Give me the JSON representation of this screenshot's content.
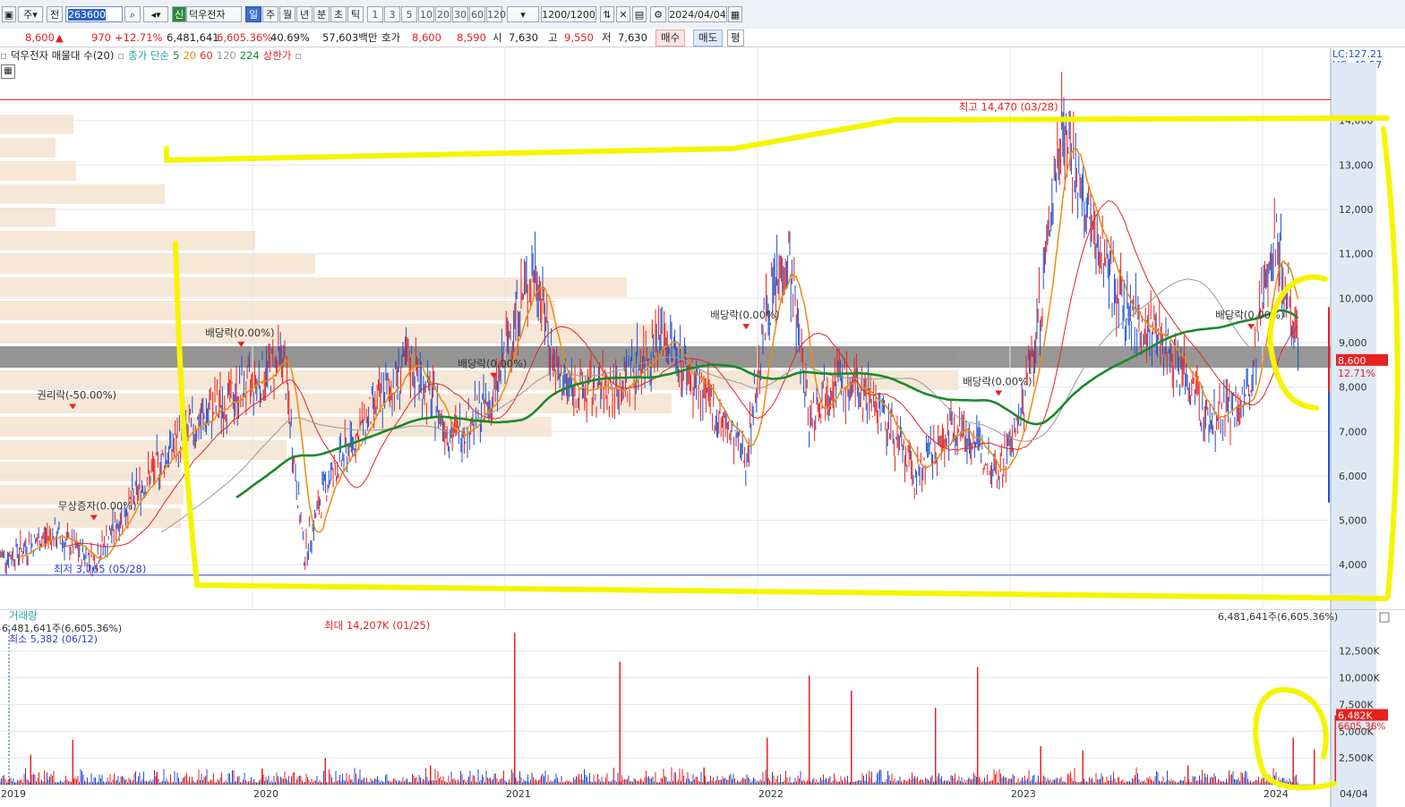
{
  "toolbar": {
    "market_btn": "주",
    "all_btn": "전",
    "code": "263600",
    "new_badge": "신",
    "stock_name": "덕우전자",
    "periods": [
      "일",
      "주",
      "월",
      "년",
      "분",
      "초",
      "틱"
    ],
    "active_period": "일",
    "intervals": [
      "1",
      "3",
      "5",
      "10",
      "20",
      "30",
      "60",
      "120"
    ],
    "count_label": "1200",
    "count_total": "/1200",
    "date": "2024/04/04"
  },
  "quote": {
    "price": "8,600",
    "change": "970",
    "change_pct": "+12.71%",
    "volume": "6,481,641",
    "volume_pct": "6,605.36%",
    "turnover": "40.69%",
    "amount": "57,603백만",
    "bid_label": "호가",
    "bid1": "8,600",
    "bid2": "8,590",
    "open_label": "시",
    "open": "7,630",
    "high_label": "고",
    "high": "9,550",
    "low_label": "저",
    "low": "7,630",
    "buy": "매수",
    "sell": "매도",
    "eval": "평"
  },
  "legend": {
    "title": "덕우전자 매물대 수(20)",
    "ma_label": "종가 단순",
    "ma5": "5",
    "ma20": "20",
    "ma60": "60",
    "ma120": "120",
    "ma224": "224",
    "upper_limit": "상한가"
  },
  "right_info": {
    "lc": "LC:127.21",
    "hc": "HC:-40.57"
  },
  "colors": {
    "up": "#e8201e",
    "down": "#1f4fd0",
    "ma5": "#f08a10",
    "ma20": "#e0242a",
    "ma60": "#9a9a9a",
    "ma224": "#1a8a2a",
    "highlight": "#f5f500",
    "volume_profile": "#f6e7d6"
  },
  "chart_data": [
    {
      "type": "line",
      "title": "",
      "x_ticks": [
        "2019",
        "2020",
        "2021",
        "2022",
        "2023",
        "2024",
        "04/04"
      ],
      "y_ticks": [
        "4,000",
        "5,000",
        "6,000",
        "7,000",
        "8,000",
        "9,000",
        "10,000",
        "11,000",
        "12,000",
        "13,000",
        "14,000"
      ],
      "ylim": [
        3300,
        14900
      ],
      "series": [
        {
          "color": "#1f4fd0",
          "x": [
            "2019-01",
            "2019-03",
            "2019-05",
            "2019-07",
            "2019-09",
            "2019-11",
            "2020-01",
            "2020-02",
            "2020-03",
            "2020-04",
            "2020-06",
            "2020-08",
            "2020-10",
            "2020-12",
            "2021-01",
            "2021-02",
            "2021-03",
            "2021-04",
            "2021-06",
            "2021-08",
            "2021-10",
            "2021-12",
            "2022-01",
            "2022-02",
            "2022-03",
            "2022-04",
            "2022-06",
            "2022-08",
            "2022-10",
            "2022-12",
            "2023-01",
            "2023-02",
            "2023-03",
            "2023-04",
            "2023-05",
            "2023-06",
            "2023-08",
            "2023-10",
            "2023-12",
            "2024-01",
            "2024-02",
            "2024-03",
            "2024-04"
          ],
          "values": [
            4200,
            4700,
            4100,
            5600,
            6800,
            7600,
            8200,
            8700,
            4200,
            5800,
            7300,
            8600,
            6900,
            7700,
            9600,
            10700,
            8200,
            7900,
            8000,
            9200,
            7800,
            6400,
            9800,
            11000,
            7300,
            8200,
            7800,
            6000,
            7200,
            6100,
            7200,
            9800,
            14200,
            12000,
            11000,
            9700,
            9000,
            7200,
            7800,
            11600,
            9600,
            7500,
            8600
          ]
        }
      ],
      "annotations": [
        {
          "text": "최고 14,470 (03/28)",
          "x": "2023-03-28",
          "y": 14470
        },
        {
          "text": "최저 3,765 (05/28)",
          "x": "2019-05-28",
          "y": 3765
        },
        {
          "text": "배당락(0.00%)",
          "x": "2019-12",
          "y": 8900
        },
        {
          "text": "배당락(0.00%)",
          "x": "2020-12",
          "y": 8200
        },
        {
          "text": "배당락(0.00%)",
          "x": "2021-12",
          "y": 9300
        },
        {
          "text": "배당락(0.00%)",
          "x": "2022-12",
          "y": 7800
        },
        {
          "text": "배당락(0.00%)",
          "x": "2023-12",
          "y": 9300
        },
        {
          "text": "권리락(-50.00%)",
          "x": "2019-04",
          "y": 7500
        },
        {
          "text": "무상증자(0.00%)",
          "x": "2019-05",
          "y": 5000
        }
      ],
      "price_label": {
        "price": "8,600",
        "pct": "12.71%"
      }
    },
    {
      "type": "bar",
      "title": "거래량",
      "info": "6,481,641주(6,605.36%)",
      "min_label": "최소 5,382 (06/12)",
      "max_label": "최대 14,207K (01/25)",
      "right_info": "6,481,641주(6,605.36%)",
      "y_ticks": [
        "2,500K",
        "5,000K",
        "7,500K",
        "10,000K",
        "12,500K"
      ],
      "ylim": [
        0,
        14900
      ],
      "current_label": "6,482K",
      "current_pct": "6605.36%",
      "x": [
        "2019-02",
        "2019-04",
        "2019-08",
        "2020-01",
        "2020-04",
        "2020-09",
        "2021-01",
        "2021-06",
        "2021-10",
        "2022-01",
        "2022-03",
        "2022-05",
        "2022-09",
        "2022-11",
        "2023-02",
        "2023-04",
        "2023-09",
        "2024-02",
        "2024-03",
        "2024-04"
      ],
      "values": [
        2800,
        4200,
        1200,
        1500,
        2500,
        1800,
        14207,
        11500,
        1600,
        4400,
        10200,
        8800,
        7200,
        11000,
        3600,
        3200,
        1800,
        4400,
        3300,
        6482
      ]
    }
  ]
}
